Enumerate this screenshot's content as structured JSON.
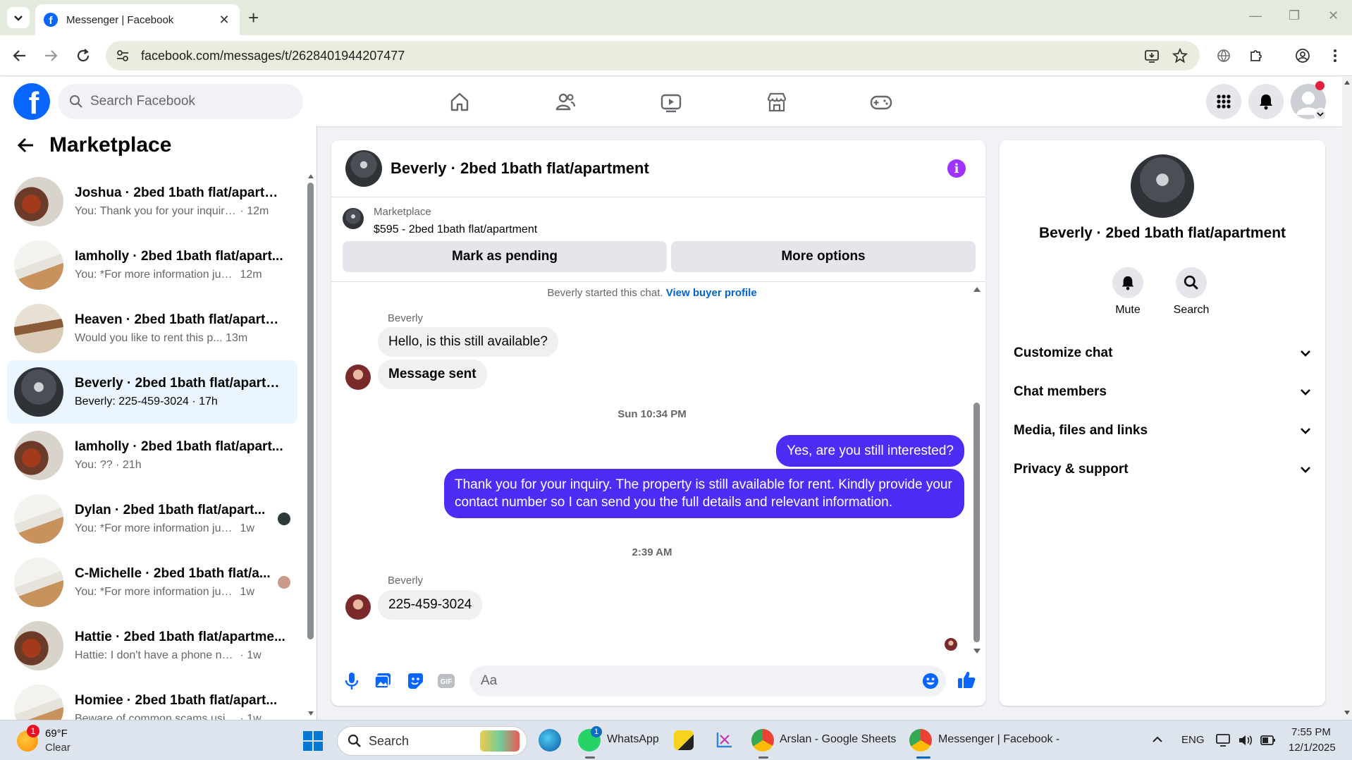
{
  "browser": {
    "tab_title": "Messenger | Facebook",
    "url": "facebook.com/messages/t/2628401944207477"
  },
  "fb_header": {
    "logo_letter": "f",
    "search_placeholder": "Search Facebook"
  },
  "left_panel": {
    "title": "Marketplace",
    "conversations": [
      {
        "name": "Joshua · 2bed 1bath flat/apartm...",
        "preview": "You: Thank you for your inquiry. T...",
        "time": "12m"
      },
      {
        "name": "Iamholly · 2bed 1bath flat/apart...",
        "preview": "You: *For more information just s...",
        "time": "12m"
      },
      {
        "name": "Heaven · 2bed 1bath flat/apartm...",
        "preview": "Would you like to rent this p...",
        "time": "13m"
      },
      {
        "name": "Beverly · 2bed 1bath flat/apartm...",
        "preview": "Beverly: 225-459-3024",
        "time": "17h"
      },
      {
        "name": "Iamholly · 2bed 1bath flat/apart...",
        "preview": "You: ??",
        "time": "21h"
      },
      {
        "name": "Dylan · 2bed 1bath flat/apart...",
        "preview": "You: *For more information just ...",
        "time": "1w"
      },
      {
        "name": "C-Michelle · 2bed 1bath flat/a...",
        "preview": "You: *For more information just ...",
        "time": "1w"
      },
      {
        "name": "Hattie · 2bed 1bath flat/apartme...",
        "preview": "Hattie: I don't have a phone number",
        "time": "1w"
      },
      {
        "name": "Homiee · 2bed 1bath flat/apart...",
        "preview": "Beware of common scams using p...",
        "time": "1w"
      }
    ]
  },
  "chat": {
    "title": "Beverly · 2bed 1bath flat/apartment",
    "marketplace_label": "Marketplace",
    "listing": "$595 - 2bed 1bath flat/apartment",
    "mark_pending_label": "Mark as pending",
    "more_options_label": "More options",
    "started_text": "Beverly started this chat.",
    "view_profile_link": "View buyer profile",
    "sender_name": "Beverly",
    "msg1": "Hello, is this still available?",
    "msg2": "Message sent",
    "timestamp1": "Sun 10:34 PM",
    "out1": "Yes, are you still interested?",
    "out2": "Thank you for your inquiry. The property is still available for rent. Kindly provide your contact number so I can send you the full details and relevant information.",
    "timestamp2": "2:39 AM",
    "sender_name2": "Beverly",
    "msg3": "225-459-3024",
    "composer_placeholder": "Aa"
  },
  "right_panel": {
    "name": "Beverly · 2bed 1bath flat/apartment",
    "mute_label": "Mute",
    "search_label": "Search",
    "sections": [
      "Customize chat",
      "Chat members",
      "Media, files and links",
      "Privacy & support"
    ]
  },
  "taskbar": {
    "weather_badge": "1",
    "temperature": "69°F",
    "condition": "Clear",
    "search_placeholder": "Search",
    "whatsapp_badge": "1",
    "whatsapp_label": "WhatsApp",
    "sheets_label": "Arslan - Google Sheets",
    "messenger_label": "Messenger | Facebook -",
    "lang": "ENG",
    "time": "7:55 PM",
    "date": "12/1/2025"
  },
  "colors": {
    "fb_blue": "#0866ff",
    "outgoing_bubble": "#4f2cf6",
    "active_conv": "#ebf5ff",
    "info_purple": "#a033ff"
  }
}
